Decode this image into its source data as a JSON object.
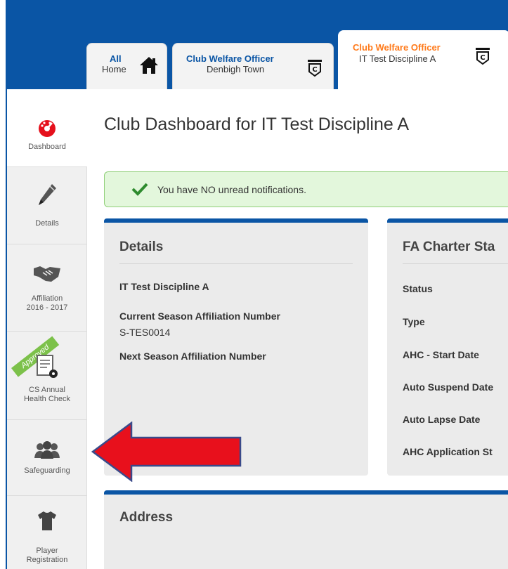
{
  "tabs": [
    {
      "title": "All",
      "subtitle": "Home",
      "icon": "home-icon"
    },
    {
      "title": "Club Welfare Officer",
      "subtitle": "Denbigh Town",
      "icon": "club-badge-icon"
    },
    {
      "title": "Club Welfare Officer",
      "subtitle": "IT Test Discipline A",
      "icon": "club-badge-icon",
      "active": true
    }
  ],
  "sidebar": {
    "items": [
      {
        "label": "Dashboard",
        "icon": "gauge-icon"
      },
      {
        "label": "Details",
        "icon": "pencil-icon"
      },
      {
        "label_line1": "Affiliation",
        "label_line2": "2016 - 2017",
        "icon": "handshake-icon"
      },
      {
        "label_line1": "CS Annual",
        "label_line2": "Health Check",
        "icon": "document-badge-icon",
        "ribbon": "Approved"
      },
      {
        "label": "Safeguarding",
        "icon": "people-icon"
      },
      {
        "label_line1": "Player",
        "label_line2": "Registration",
        "icon": "shirt-icon"
      }
    ]
  },
  "main": {
    "title": "Club Dashboard for IT Test Discipline A",
    "notification": "You have NO unread notifications.",
    "details": {
      "heading": "Details",
      "club_name": "IT Test Discipline A",
      "current_label": "Current Season Affiliation Number",
      "current_value": "S-TES0014",
      "next_label": "Next Season Affiliation Number"
    },
    "charter": {
      "heading": "FA Charter Sta",
      "rows": [
        "Status",
        "Type",
        "AHC - Start Date",
        "Auto Suspend Date",
        "Auto Lapse Date",
        "AHC Application St"
      ]
    },
    "address": {
      "heading": "Address"
    }
  },
  "colors": {
    "brand_blue": "#0a55a5",
    "active_tab_title": "#ff7a1a",
    "approved_green": "#7cc14a",
    "success_bg": "#e3f7dc",
    "arrow_red": "#e8101c"
  }
}
